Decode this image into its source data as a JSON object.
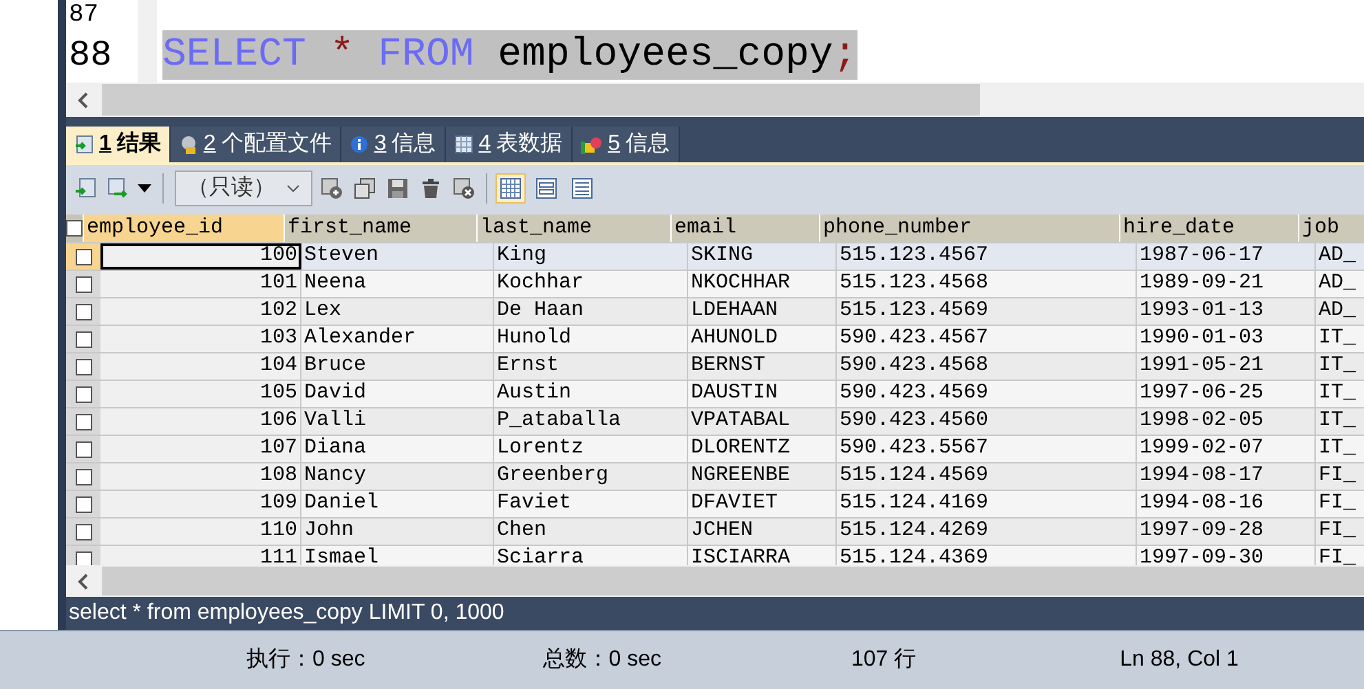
{
  "editor": {
    "lines": [
      {
        "number": "87"
      },
      {
        "number": "88",
        "selected": true,
        "tokens": [
          {
            "kind": "keyword",
            "text": "SELECT"
          },
          {
            "kind": "operator",
            "text": "*"
          },
          {
            "kind": "keyword",
            "text": "FROM"
          },
          {
            "kind": "identifier",
            "text": "employees_copy"
          },
          {
            "kind": "punctuation",
            "text": ";"
          }
        ]
      }
    ]
  },
  "tabs": [
    {
      "number": "1",
      "label": "结果",
      "selected": true
    },
    {
      "number": "2",
      "label": "个配置文件",
      "selected": false
    },
    {
      "number": "3",
      "label": "信息",
      "selected": false
    },
    {
      "number": "4",
      "label": "表数据",
      "selected": false
    },
    {
      "number": "5",
      "label": "信息",
      "selected": false
    }
  ],
  "toolbar": {
    "mode_select": "（只读）",
    "views": [
      {
        "kind": "grid",
        "selected": true
      },
      {
        "kind": "form",
        "selected": false
      },
      {
        "kind": "text",
        "selected": false
      }
    ]
  },
  "table": {
    "all_checked": false,
    "columns": [
      "employee_id",
      "first_name",
      "last_name",
      "email",
      "phone_number",
      "hire_date",
      "job"
    ],
    "rows": [
      {
        "checked": false,
        "selected": true,
        "cells": [
          "100",
          "Steven",
          "King",
          "SKING",
          "515.123.4567",
          "1987-06-17",
          "AD_"
        ]
      },
      {
        "checked": false,
        "selected": false,
        "cells": [
          "101",
          "Neena",
          "Kochhar",
          "NKOCHHAR",
          "515.123.4568",
          "1989-09-21",
          "AD_"
        ]
      },
      {
        "checked": false,
        "selected": false,
        "cells": [
          "102",
          "Lex",
          "De Haan",
          "LDEHAAN",
          "515.123.4569",
          "1993-01-13",
          "AD_"
        ]
      },
      {
        "checked": false,
        "selected": false,
        "cells": [
          "103",
          "Alexander",
          "Hunold",
          "AHUNOLD",
          "590.423.4567",
          "1990-01-03",
          "IT_"
        ]
      },
      {
        "checked": false,
        "selected": false,
        "cells": [
          "104",
          "Bruce",
          "Ernst",
          "BERNST",
          "590.423.4568",
          "1991-05-21",
          "IT_"
        ]
      },
      {
        "checked": false,
        "selected": false,
        "cells": [
          "105",
          "David",
          "Austin",
          "DAUSTIN",
          "590.423.4569",
          "1997-06-25",
          "IT_"
        ]
      },
      {
        "checked": false,
        "selected": false,
        "cells": [
          "106",
          "Valli",
          "P_ataballa",
          "VPATABAL",
          "590.423.4560",
          "1998-02-05",
          "IT_"
        ]
      },
      {
        "checked": false,
        "selected": false,
        "cells": [
          "107",
          "Diana",
          "Lorentz",
          "DLORENTZ",
          "590.423.5567",
          "1999-02-07",
          "IT_"
        ]
      },
      {
        "checked": false,
        "selected": false,
        "cells": [
          "108",
          "Nancy",
          "Greenberg",
          "NGREENBE",
          "515.124.4569",
          "1994-08-17",
          "FI_"
        ]
      },
      {
        "checked": false,
        "selected": false,
        "cells": [
          "109",
          "Daniel",
          "Faviet",
          "DFAVIET",
          "515.124.4169",
          "1994-08-16",
          "FI_"
        ]
      },
      {
        "checked": false,
        "selected": false,
        "cells": [
          "110",
          "John",
          "Chen",
          "JCHEN",
          "515.124.4269",
          "1997-09-28",
          "FI_"
        ]
      },
      {
        "checked": false,
        "selected": false,
        "cells": [
          "111",
          "Ismael",
          "Sciarra",
          "ISCIARRA",
          "515.124.4369",
          "1997-09-30",
          "FI_"
        ]
      }
    ]
  },
  "query_status": "select * from employees_copy LIMIT 0, 1000",
  "status_bar": [
    "执行：0 sec",
    "总数：0 sec",
    "107 行",
    "Ln 88, Col 1"
  ]
}
